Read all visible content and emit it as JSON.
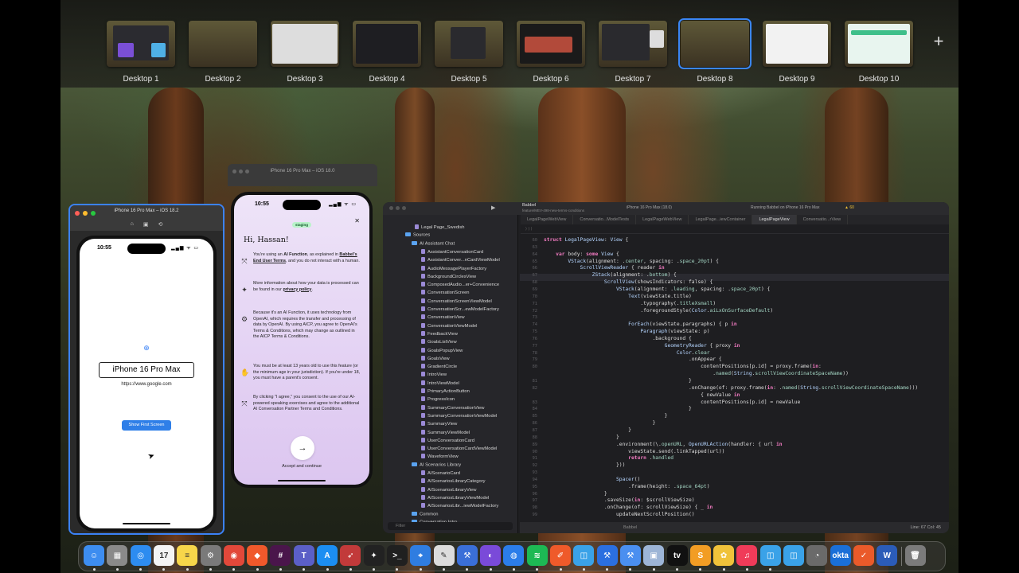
{
  "mission_control": {
    "desktops": [
      {
        "label": "Desktop 1",
        "active": false
      },
      {
        "label": "Desktop 2",
        "active": false
      },
      {
        "label": "Desktop 3",
        "active": false
      },
      {
        "label": "Desktop 4",
        "active": false
      },
      {
        "label": "Desktop 5",
        "active": false
      },
      {
        "label": "Desktop 6",
        "active": false
      },
      {
        "label": "Desktop 7",
        "active": false
      },
      {
        "label": "Desktop 8",
        "active": true
      },
      {
        "label": "Desktop 9",
        "active": false
      },
      {
        "label": "Desktop 10",
        "active": false
      }
    ],
    "add_desktop_symbol": "+"
  },
  "simulator1": {
    "window_title": "iPhone 16 Pro Max – iOS 18.2",
    "status_time": "10:55",
    "status_icons": "▂▄▆ ᯤ ▭",
    "globe_symbol": "⊕",
    "device_label": "iPhone 16 Pro Max",
    "url": "https://www.google.com",
    "button_label": "Show First Screen",
    "toolbar_icons": [
      "⌂",
      "▣",
      "⟲"
    ]
  },
  "simulator2": {
    "window_title": "iPhone 16 Pro Max – iOS 18.0",
    "status_time": "10:55",
    "status_icons": "▂▄▆ ᯤ ▭",
    "badge": "staging",
    "close_symbol": "✕",
    "greeting": "Hi, Hassan!",
    "paragraphs": [
      {
        "icon": "⤧",
        "pre": "You're using an ",
        "bold": "AI Function",
        "mid": ", as explained in ",
        "link": "Babbel's End User Terms",
        "post": ", and you do not interact with a human."
      },
      {
        "icon": "✦",
        "pre": "More information about how your data is processed can be found in our ",
        "bold": "",
        "mid": "",
        "link": "privacy policy",
        "post": "."
      },
      {
        "icon": "⚙",
        "pre": "Because it's an AI Function, it uses technology from OpenAI, which requires the transfer and processing of data by OpenAI. By using AICP, you agree to OpenAI's Terms & Conditions, which may change as outlined in the AICP Terms & Conditions.",
        "bold": "",
        "mid": "",
        "link": "",
        "post": ""
      },
      {
        "icon": "✋",
        "pre": "You must be at least 13 years old to use this feature (or the minimum age in your jurisdiction). If you're under 18, you must have a parent's consent.",
        "bold": "",
        "mid": "",
        "link": "",
        "post": ""
      },
      {
        "icon": "⤧",
        "pre": "By clicking \"I agree,\" you consent to the use of our AI-powered speaking exercises and agree to the additional AI Conversation Partner Terms and Conditions.",
        "bold": "",
        "mid": "",
        "link": "",
        "post": ""
      }
    ],
    "continue_arrow": "→",
    "accept_label": "Accept and continue"
  },
  "xcode": {
    "project": "Babbel",
    "branch": "feature/MEV-498-new-terms-conditions",
    "scheme": "iPhone 16 Pro Max (18.0)",
    "activity": "Running Babbel on iPhone 16 Pro Max",
    "warnings": "▲ 60",
    "tabs": [
      {
        "label": "LegalPageWebView",
        "active": false
      },
      {
        "label": "Conversatio...ModelTests",
        "active": false
      },
      {
        "label": "LegalPageWebView",
        "active": false
      },
      {
        "label": "LegalPage...iewContainer",
        "active": false
      },
      {
        "label": "LegalPageView",
        "active": true
      },
      {
        "label": "Conversatio...rView",
        "active": false
      }
    ],
    "navigator": [
      {
        "label": "Legal Page_Swedish",
        "indent": 40,
        "kind": "file"
      },
      {
        "label": "Sources",
        "indent": 28,
        "kind": "dir"
      },
      {
        "label": "AI Assistant Chat",
        "indent": 36,
        "kind": "dir"
      },
      {
        "label": "AssistantConversationCard",
        "indent": 48,
        "kind": "file"
      },
      {
        "label": "AssistantConver...nCardViewModel",
        "indent": 48,
        "kind": "file"
      },
      {
        "label": "AudioMessagePlayerFactory",
        "indent": 48,
        "kind": "file"
      },
      {
        "label": "BackgroundCirclesView",
        "indent": 48,
        "kind": "file"
      },
      {
        "label": "ComposedAudio...er+Convenience",
        "indent": 48,
        "kind": "file"
      },
      {
        "label": "ConversationScreen",
        "indent": 48,
        "kind": "file"
      },
      {
        "label": "ConversationScreenViewModel",
        "indent": 48,
        "kind": "file"
      },
      {
        "label": "ConversationScr...ewModelFactory",
        "indent": 48,
        "kind": "file"
      },
      {
        "label": "ConversationView",
        "indent": 48,
        "kind": "file"
      },
      {
        "label": "ConversationViewModel",
        "indent": 48,
        "kind": "file"
      },
      {
        "label": "FeedbackView",
        "indent": 48,
        "kind": "file"
      },
      {
        "label": "GoalsListView",
        "indent": 48,
        "kind": "file"
      },
      {
        "label": "GoalsPopupView",
        "indent": 48,
        "kind": "file"
      },
      {
        "label": "GoalsView",
        "indent": 48,
        "kind": "file"
      },
      {
        "label": "GradientCircle",
        "indent": 48,
        "kind": "file"
      },
      {
        "label": "IntroView",
        "indent": 48,
        "kind": "file"
      },
      {
        "label": "IntroViewModel",
        "indent": 48,
        "kind": "file"
      },
      {
        "label": "PrimaryActionButton",
        "indent": 48,
        "kind": "file"
      },
      {
        "label": "ProgressIcon",
        "indent": 48,
        "kind": "file"
      },
      {
        "label": "SummaryConversationView",
        "indent": 48,
        "kind": "file"
      },
      {
        "label": "SummaryConversationViewModel",
        "indent": 48,
        "kind": "file"
      },
      {
        "label": "SummaryView",
        "indent": 48,
        "kind": "file"
      },
      {
        "label": "SummaryViewModel",
        "indent": 48,
        "kind": "file"
      },
      {
        "label": "UserConversationCard",
        "indent": 48,
        "kind": "file"
      },
      {
        "label": "UserConversationCardViewModel",
        "indent": 48,
        "kind": "file"
      },
      {
        "label": "WaveformView",
        "indent": 48,
        "kind": "file"
      },
      {
        "label": "AI Scenarios Library",
        "indent": 36,
        "kind": "dir"
      },
      {
        "label": "AIScenarioCard",
        "indent": 48,
        "kind": "file"
      },
      {
        "label": "AIScenariosLibraryCategory",
        "indent": 48,
        "kind": "file"
      },
      {
        "label": "AIScenariosLibraryView",
        "indent": 48,
        "kind": "file"
      },
      {
        "label": "AIScenariosLibraryViewModel",
        "indent": 48,
        "kind": "file"
      },
      {
        "label": "AIScenariosLibr...iewModelFactory",
        "indent": 48,
        "kind": "file"
      },
      {
        "label": "Common",
        "indent": 36,
        "kind": "dir"
      },
      {
        "label": "Conversation Intro",
        "indent": 36,
        "kind": "dir"
      }
    ],
    "filter_placeholder": "Filter",
    "code_lines": [
      {
        "n": "60",
        "text": "struct LegalPageView: View {"
      },
      {
        "n": "63",
        "text": ""
      },
      {
        "n": "64",
        "text": "    var body: some View {"
      },
      {
        "n": "65",
        "text": "        VStack(alignment: .center, spacing: .space_20pt) {"
      },
      {
        "n": "66",
        "text": "            ScrollViewReader { reader in"
      },
      {
        "n": "67",
        "text": "                ZStack(alignment: .bottom) {"
      },
      {
        "n": "68",
        "text": "                    ScrollView(showsIndicators: false) {"
      },
      {
        "n": "69",
        "text": "                        VStack(alignment: .leading, spacing: .space_20pt) {"
      },
      {
        "n": "70",
        "text": "                            Text(viewState.title)"
      },
      {
        "n": "71",
        "text": "                                .typography(.titleXsmall)"
      },
      {
        "n": "72",
        "text": "                                .foregroundStyle(Color.aiLxOnSurfaceDefault)"
      },
      {
        "n": "73",
        "text": ""
      },
      {
        "n": "74",
        "text": "                            ForEach(viewState.paragraphs) { p in"
      },
      {
        "n": "75",
        "text": "                                Paragraph(viewState: p)"
      },
      {
        "n": "76",
        "text": "                                    .background {"
      },
      {
        "n": "77",
        "text": "                                        GeometryReader { proxy in"
      },
      {
        "n": "78",
        "text": "                                            Color.clear"
      },
      {
        "n": "79",
        "text": "                                                .onAppear {"
      },
      {
        "n": "80",
        "text": "                                                    contentPositions[p.id] = proxy.frame(in:"
      },
      {
        "n": "",
        "text": "                                                        .named(String.scrollViewCoordinateSpaceName))"
      },
      {
        "n": "81",
        "text": "                                                }"
      },
      {
        "n": "82",
        "text": "                                                .onChange(of: proxy.frame(in: .named(String.scrollViewCoordinateSpaceName)))"
      },
      {
        "n": "",
        "text": "                                                    { newValue in"
      },
      {
        "n": "83",
        "text": "                                                    contentPositions[p.id] = newValue"
      },
      {
        "n": "84",
        "text": "                                                }"
      },
      {
        "n": "85",
        "text": "                                        }"
      },
      {
        "n": "86",
        "text": "                                    }"
      },
      {
        "n": "87",
        "text": "                            }"
      },
      {
        "n": "88",
        "text": "                        }"
      },
      {
        "n": "89",
        "text": "                        .environment(\\.openURL, OpenURLAction(handler: { url in"
      },
      {
        "n": "90",
        "text": "                            viewState.send(.linkTapped(url))"
      },
      {
        "n": "91",
        "text": "                            return .handled"
      },
      {
        "n": "92",
        "text": "                        }))"
      },
      {
        "n": "93",
        "text": ""
      },
      {
        "n": "94",
        "text": "                        Spacer()"
      },
      {
        "n": "95",
        "text": "                            .frame(height: .space_64pt)"
      },
      {
        "n": "96",
        "text": "                    }"
      },
      {
        "n": "97",
        "text": "                    .saveSize(in: $scrollViewSize)"
      },
      {
        "n": "98",
        "text": "                    .onChange(of: scrollViewSize) { _ in"
      },
      {
        "n": "99",
        "text": "                        updateNextScrollPosition()"
      }
    ],
    "status_position": "Line: 67  Col: 45",
    "status_target": "Babbel"
  },
  "dock": {
    "apps": [
      {
        "name": "finder-icon",
        "glyph": "☺",
        "color": "#3d8df0"
      },
      {
        "name": "launchpad-icon",
        "glyph": "▦",
        "color": "#8a8a8a"
      },
      {
        "name": "safari-icon",
        "glyph": "◎",
        "color": "#2d8cf0"
      },
      {
        "name": "calendar-icon",
        "glyph": "17",
        "color": "#f4f4f4"
      },
      {
        "name": "notes-icon",
        "glyph": "≡",
        "color": "#f7d64a"
      },
      {
        "name": "system-settings-icon",
        "glyph": "⚙",
        "color": "#7a7a7a"
      },
      {
        "name": "chrome-icon",
        "glyph": "◉",
        "color": "#e2483a"
      },
      {
        "name": "brave-icon",
        "glyph": "◆",
        "color": "#f0592b"
      },
      {
        "name": "slack-icon",
        "glyph": "#",
        "color": "#4a154b"
      },
      {
        "name": "teams-icon",
        "glyph": "T",
        "color": "#5b5fc7"
      },
      {
        "name": "app-store-icon",
        "glyph": "A",
        "color": "#1b8ef2"
      },
      {
        "name": "fly-icon",
        "glyph": "➶",
        "color": "#c23a3a"
      },
      {
        "name": "figma-icon",
        "glyph": "✦",
        "color": "#222"
      },
      {
        "name": "terminal-icon",
        "glyph": ">_",
        "color": "#202020"
      },
      {
        "name": "maps-icon",
        "glyph": "⌖",
        "color": "#2f7de1"
      },
      {
        "name": "script-editor-icon",
        "glyph": "✎",
        "color": "#dcdcdc"
      },
      {
        "name": "instruments-icon",
        "glyph": "⚒",
        "color": "#3a6fd8"
      },
      {
        "name": "github-icon",
        "glyph": "◐",
        "color": "#7a4ad9"
      },
      {
        "name": "proxyman-icon",
        "glyph": "◍",
        "color": "#2b7de9"
      },
      {
        "name": "spotify-icon",
        "glyph": "≋",
        "color": "#1db954"
      },
      {
        "name": "pen-icon",
        "glyph": "✐",
        "color": "#ef5a2a"
      },
      {
        "name": "simulator-icon",
        "glyph": "◫",
        "color": "#3aa2e8"
      },
      {
        "name": "xcode-icon",
        "glyph": "⚒",
        "color": "#2b6fe0"
      },
      {
        "name": "xcode-beta-icon",
        "glyph": "⚒",
        "color": "#4a8ff0"
      },
      {
        "name": "preview-icon",
        "glyph": "▣",
        "color": "#9db5d6"
      },
      {
        "name": "apple-tv-icon",
        "glyph": "tv",
        "color": "#111"
      },
      {
        "name": "sublime-icon",
        "glyph": "S",
        "color": "#f29d24"
      },
      {
        "name": "photos-icon",
        "glyph": "✿",
        "color": "#f0c23a"
      },
      {
        "name": "music-icon",
        "glyph": "♫",
        "color": "#f03b59"
      },
      {
        "name": "simulator2-icon",
        "glyph": "◫",
        "color": "#3aa2e8"
      },
      {
        "name": "simulator3-icon",
        "glyph": "◫",
        "color": "#3aa2e8"
      },
      {
        "name": "instruments2-icon",
        "glyph": "◔",
        "color": "#6a6a6a"
      },
      {
        "name": "okta-icon",
        "glyph": "okta",
        "color": "#1a6fd8"
      },
      {
        "name": "todoist-icon",
        "glyph": "✓",
        "color": "#ea5a2a"
      },
      {
        "name": "word-icon",
        "glyph": "W",
        "color": "#2b5cb8"
      },
      {
        "name": "trash-icon",
        "glyph": "🗑",
        "color": "#7b7b7b"
      }
    ]
  }
}
